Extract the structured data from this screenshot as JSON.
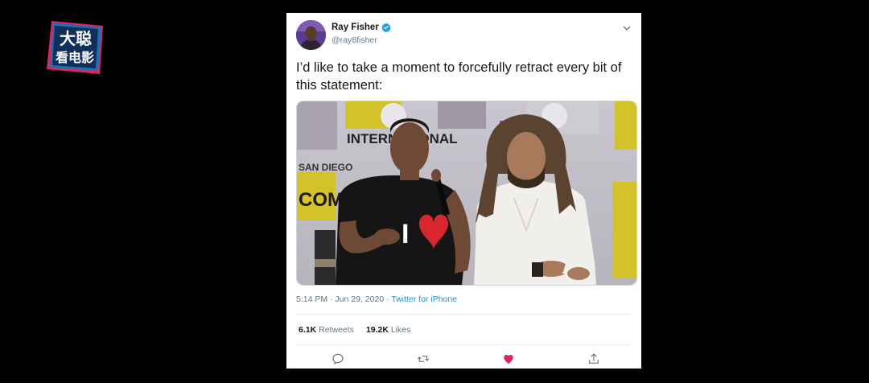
{
  "tweet": {
    "display_name": "Ray Fisher",
    "handle": "@ray8fisher",
    "text": "I’d like to take a moment to forcefully retract every bit of this statement:",
    "timestamp": "5:14 PM · Jun 29, 2020",
    "separator": " · ",
    "source": "Twitter for iPhone",
    "retweets_count": "6.1K",
    "retweets_label": "Retweets",
    "likes_count": "19.2K",
    "likes_label": "Likes",
    "liked": true
  },
  "media": {
    "backdrop_text_1": "INTERNATIONAL",
    "backdrop_text_2": "SAN DIEGO",
    "backdrop_text_3": "COMIC CON",
    "shirt_text": "I"
  },
  "watermark": {
    "line1": "大聪",
    "line2": "看电影"
  },
  "colors": {
    "twitter_blue": "#1da1f2",
    "like_red": "#e0245e",
    "text_primary": "#14171a",
    "text_secondary": "#657786"
  },
  "icons": {
    "verified": "verified-badge-icon",
    "more": "chevron-down-icon",
    "reply": "reply-icon",
    "retweet": "retweet-icon",
    "like": "heart-icon",
    "share": "share-icon"
  }
}
